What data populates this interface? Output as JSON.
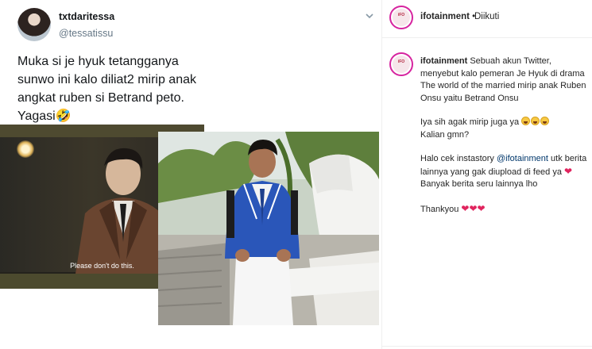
{
  "tweet": {
    "name": "txtdaritessa",
    "handle": "@tessatissu",
    "text": "Muka si je hyuk tetangganya\nsunwo ini kalo diliat2 mirip anak\nangkat ruben si Betrand peto.\nYagasi",
    "text_emoji": "🤣",
    "menu_icon": "chevron-down-icon",
    "subtitle": "Please don't do this."
  },
  "instagram": {
    "account": "ifotainment",
    "dot": " • ",
    "follow_status": "Diikuti",
    "caption": {
      "username": "ifotainment",
      "line1": " Sebuah akun Twitter, menyebut kalo pemeran Je Hyuk di drama The world of the married mirip anak Ruben Onsu yaitu Betrand Onsu",
      "line2": "Iya sih agak mirip juga ya ",
      "line2b": "Kalian gmn?",
      "line3a": "Halo cek instastory ",
      "mention": "@ifotainment",
      "line3b": " utk berita lainnya yang gak diupload di feed ya ",
      "line3c": " Banyak berita seru lainnya lho",
      "line4": "Thankyou "
    },
    "colors": {
      "ring": "#d6249f",
      "heart": "#e0245e",
      "mention": "#00376b"
    }
  }
}
